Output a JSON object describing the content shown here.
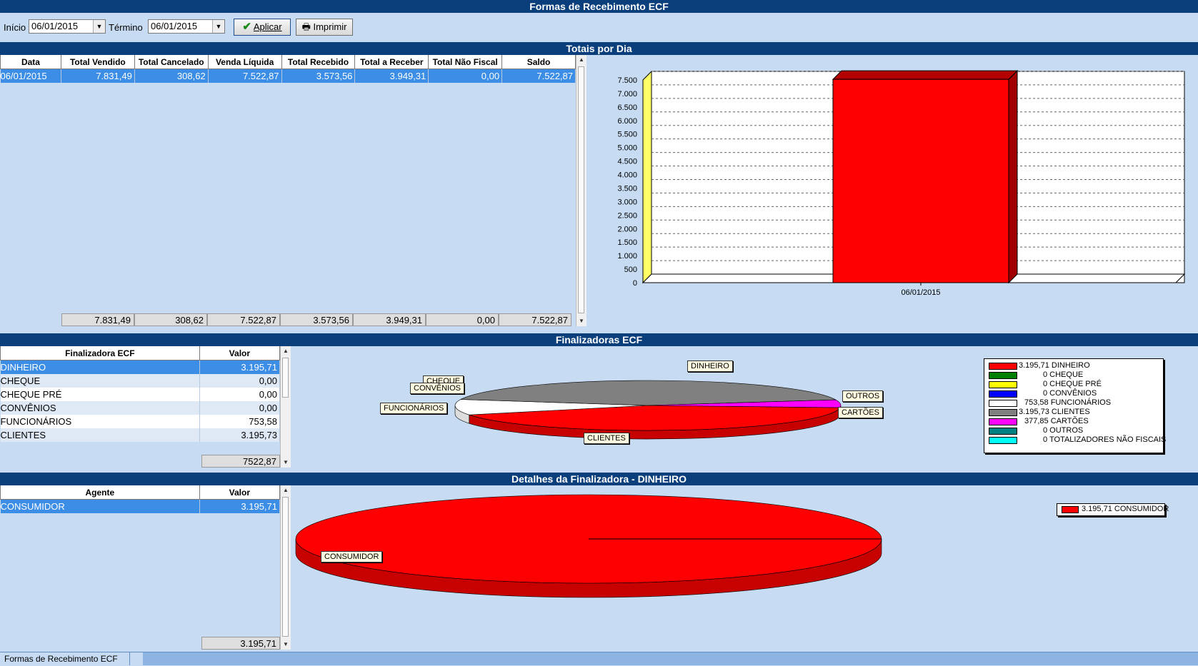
{
  "window": {
    "title": "Formas de Recebimento ECF"
  },
  "toolbar": {
    "inicio_label": "Início",
    "inicio_value": "06/01/2015",
    "termino_label": "Término",
    "termino_value": "06/01/2015",
    "aplicar_label": "Aplicar",
    "imprimir_label": "Imprimir"
  },
  "totais": {
    "title": "Totais por Dia",
    "columns": [
      "Data",
      "Total Vendido",
      "Total Cancelado",
      "Venda Líquida",
      "Total Recebido",
      "Total a Receber",
      "Total Não Fiscal",
      "Saldo"
    ],
    "rows": [
      [
        "06/01/2015",
        "7.831,49",
        "308,62",
        "7.522,87",
        "3.573,56",
        "3.949,31",
        "0,00",
        "7.522,87"
      ]
    ],
    "footer": [
      "7.831,49",
      "308,62",
      "7.522,87",
      "3.573,56",
      "3.949,31",
      "0,00",
      "7.522,87"
    ]
  },
  "chart_data": [
    {
      "type": "bar",
      "categories": [
        "06/01/2015"
      ],
      "values": [
        7522.87
      ],
      "ylim": [
        0,
        7500
      ],
      "yticks": [
        "0",
        "500",
        "1.000",
        "1.500",
        "2.000",
        "2.500",
        "3.000",
        "3.500",
        "4.000",
        "4.500",
        "5.000",
        "5.500",
        "6.000",
        "6.500",
        "7.000",
        "7.500"
      ],
      "grid": true,
      "color": "#ff0000"
    },
    {
      "type": "pie",
      "categories": [
        "DINHEIRO",
        "CHEQUE",
        "CHEQUE PRÉ",
        "CONVÊNIOS",
        "FUNCIONÁRIOS",
        "CLIENTES",
        "CARTÕES",
        "OUTROS",
        "TOTALIZADORES NÃO FISCAIS"
      ],
      "values": [
        3195.71,
        0,
        0,
        0,
        753.58,
        3195.73,
        377.85,
        0,
        0
      ],
      "colors": [
        "#ff0000",
        "#008000",
        "#ffff00",
        "#0000ff",
        "#ffffff",
        "#808080",
        "#ff00ff",
        "#008080",
        "#00ffff"
      ]
    },
    {
      "type": "pie",
      "categories": [
        "CONSUMIDOR"
      ],
      "values": [
        3195.71
      ],
      "colors": [
        "#ff0000"
      ]
    }
  ],
  "finalizadoras": {
    "title": "Finalizadoras ECF",
    "columns": [
      "Finalizadora ECF",
      "Valor"
    ],
    "rows": [
      [
        "DINHEIRO",
        "3.195,71"
      ],
      [
        "CHEQUE",
        "0,00"
      ],
      [
        "CHEQUE PRÉ",
        "0,00"
      ],
      [
        "CONVÊNIOS",
        "0,00"
      ],
      [
        "FUNCIONÁRIOS",
        "753,58"
      ],
      [
        "CLIENTES",
        "3.195,73"
      ]
    ],
    "footer": "7522,87",
    "pie_labels": [
      "DINHEIRO",
      "CHEQUE",
      "CONVÊNIOS",
      "FUNCIONÁRIOS",
      "OUTROS",
      "CARTÕES",
      "CLIENTES"
    ],
    "legend": [
      {
        "value": "3.195,71",
        "label": "DINHEIRO",
        "color": "#ff0000"
      },
      {
        "value": "0",
        "label": "CHEQUE",
        "color": "#008000"
      },
      {
        "value": "0",
        "label": "CHEQUE PRÉ",
        "color": "#ffff00"
      },
      {
        "value": "0",
        "label": "CONVÊNIOS",
        "color": "#0000ff"
      },
      {
        "value": "753,58",
        "label": "FUNCIONÁRIOS",
        "color": "#ffffff"
      },
      {
        "value": "3.195,73",
        "label": "CLIENTES",
        "color": "#808080"
      },
      {
        "value": "377,85",
        "label": "CARTÕES",
        "color": "#ff00ff"
      },
      {
        "value": "0",
        "label": "OUTROS",
        "color": "#008080"
      },
      {
        "value": "0",
        "label": "TOTALIZADORES NÃO FISCAIS",
        "color": "#00ffff"
      }
    ]
  },
  "detalhes": {
    "title": "Detalhes da Finalizadora - DINHEIRO",
    "columns": [
      "Agente",
      "Valor"
    ],
    "rows": [
      [
        "CONSUMIDOR",
        "3.195,71"
      ]
    ],
    "footer": "3.195,71",
    "pie_label": "CONSUMIDOR",
    "legend": [
      {
        "value": "3.195,71",
        "label": "CONSUMIDOR",
        "color": "#ff0000"
      }
    ]
  },
  "tabbar": {
    "tab_label": "Formas de Recebimento ECF"
  }
}
